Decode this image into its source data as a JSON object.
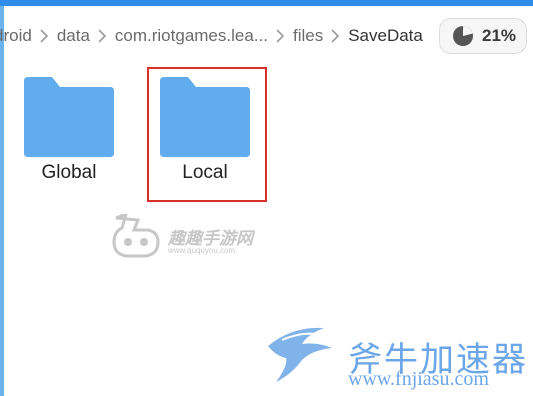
{
  "colors": {
    "accent": "#2f8ce8",
    "folder": "#61acef",
    "selection": "#d9302e"
  },
  "breadcrumb": {
    "items": [
      {
        "label": "droid"
      },
      {
        "label": "data"
      },
      {
        "label": "com.riotgames.lea..."
      },
      {
        "label": "files"
      },
      {
        "label": "SaveData"
      }
    ]
  },
  "storage": {
    "percent_label": "21%",
    "used_fraction": 0.21,
    "icon": "pie-chart-icon"
  },
  "folders": [
    {
      "name": "Global",
      "icon": "folder-icon",
      "selected": false
    },
    {
      "name": "Local",
      "icon": "folder-icon",
      "selected": true
    }
  ],
  "watermarks": [
    {
      "text": "趣趣手游网",
      "subtext": "www.ququyou.com"
    },
    {
      "text": "斧牛加速器",
      "subtext": "www.fnjiasu.com"
    }
  ]
}
